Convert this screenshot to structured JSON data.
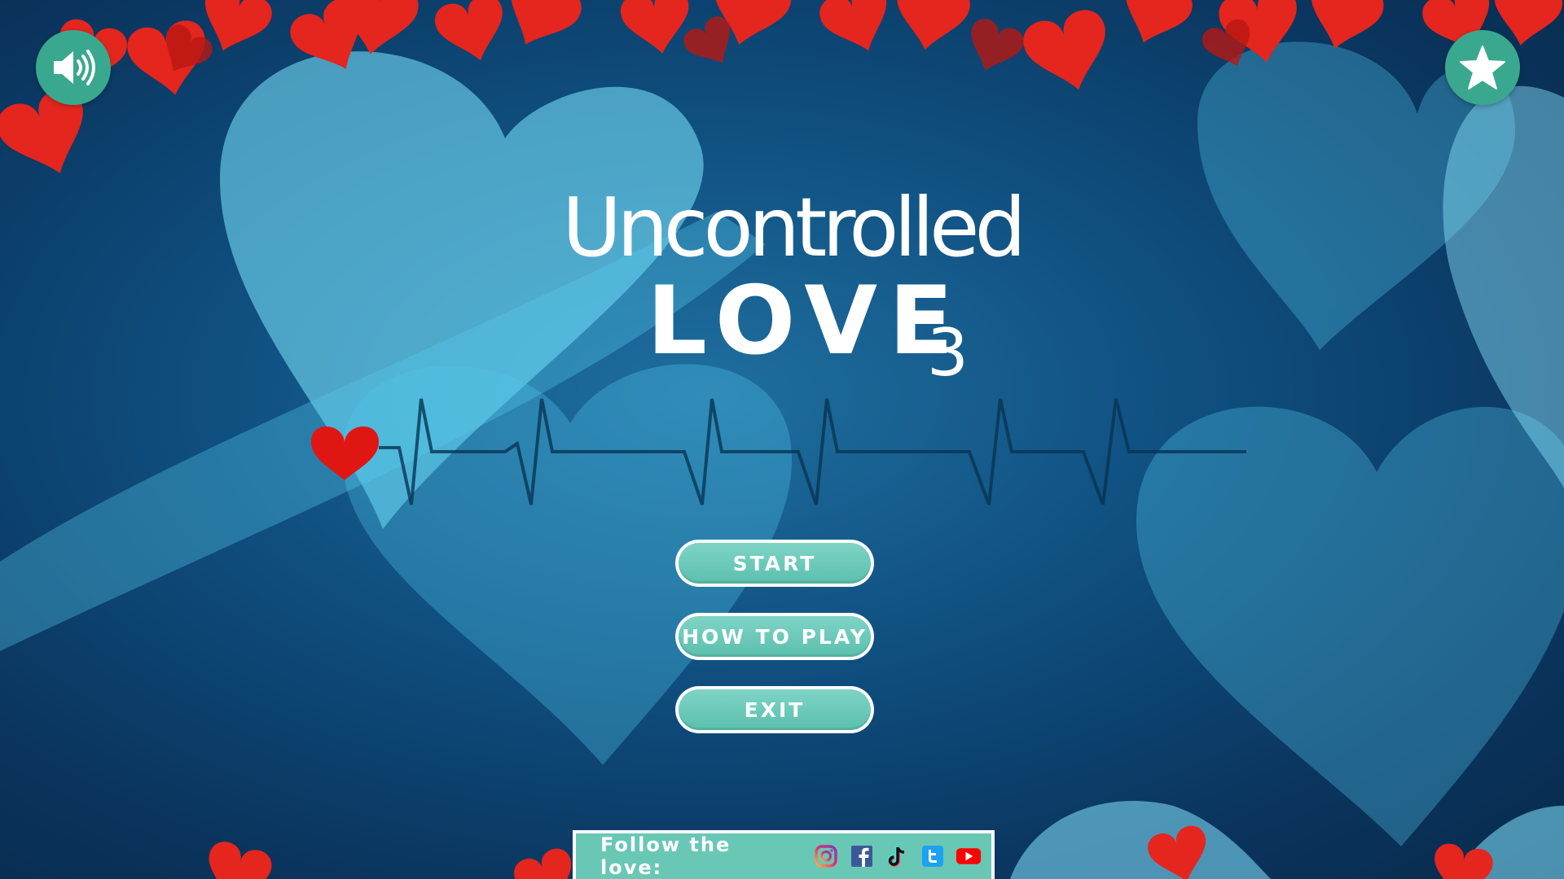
{
  "title": {
    "line1": "Uncontrolled",
    "line2": "LOVE",
    "line3": "3"
  },
  "menu": {
    "start": "START",
    "how_to_play": "HOW TO PLAY",
    "exit": "EXIT"
  },
  "footer": {
    "follow_label": "Follow the love:",
    "socials": [
      "instagram-icon",
      "facebook-icon",
      "tiktok-icon",
      "twitter-icon",
      "youtube-icon"
    ]
  },
  "icons": {
    "sound": "speaker-icon",
    "favorite": "star-icon"
  },
  "colors": {
    "accent": "#3aa88e",
    "button_fill": "#6ccab9",
    "heart_red": "#e0201c",
    "background_dark": "#0a355e",
    "background_light": "#5fd9f0"
  }
}
